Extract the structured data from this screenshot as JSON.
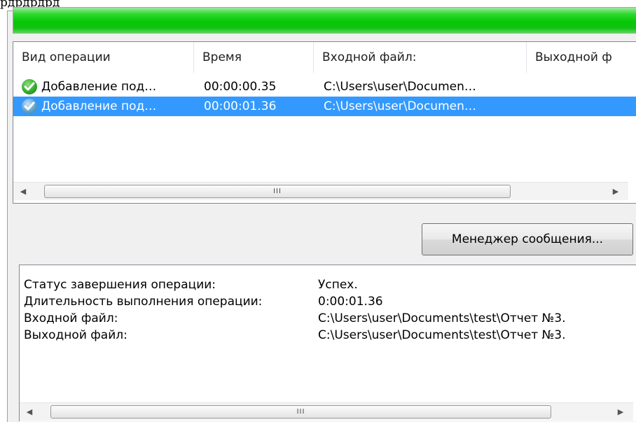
{
  "window": {
    "top_partial_text": "рдрдрдрд"
  },
  "progress": {
    "fraction": 1.0,
    "color": "#06c806"
  },
  "operations_list": {
    "columns": [
      "Вид операции",
      "Время",
      "Входной файл:",
      "Выходной ф"
    ],
    "rows": [
      {
        "icon": "check-circle-icon",
        "operation": "Добавление под…",
        "time": "00:00:00.35",
        "input_file": "C:\\Users\\user\\Documen…",
        "output_file": "",
        "selected": false
      },
      {
        "icon": "check-circle-icon",
        "operation": "Добавление под…",
        "time": "00:00:01.36",
        "input_file": "C:\\Users\\user\\Documen…",
        "output_file": "",
        "selected": true
      }
    ],
    "scroll_grip": "III"
  },
  "message_manager_button": {
    "label": "Менеджер сообщения..."
  },
  "details": {
    "rows": [
      {
        "label": "Статус завершения операции:",
        "value": "Успех."
      },
      {
        "label": "Длительность выполнения операции:",
        "value": "0:00:01.36"
      },
      {
        "label": "Входной файл:",
        "value": "C:\\Users\\user\\Documents\\test\\Отчет №3."
      },
      {
        "label": "Выходной файл:",
        "value": "C:\\Users\\user\\Documents\\test\\Отчет №3."
      }
    ],
    "scroll_grip": "III"
  },
  "colors": {
    "selection": "#3399ff",
    "panel_bg": "#f0f0f0"
  }
}
